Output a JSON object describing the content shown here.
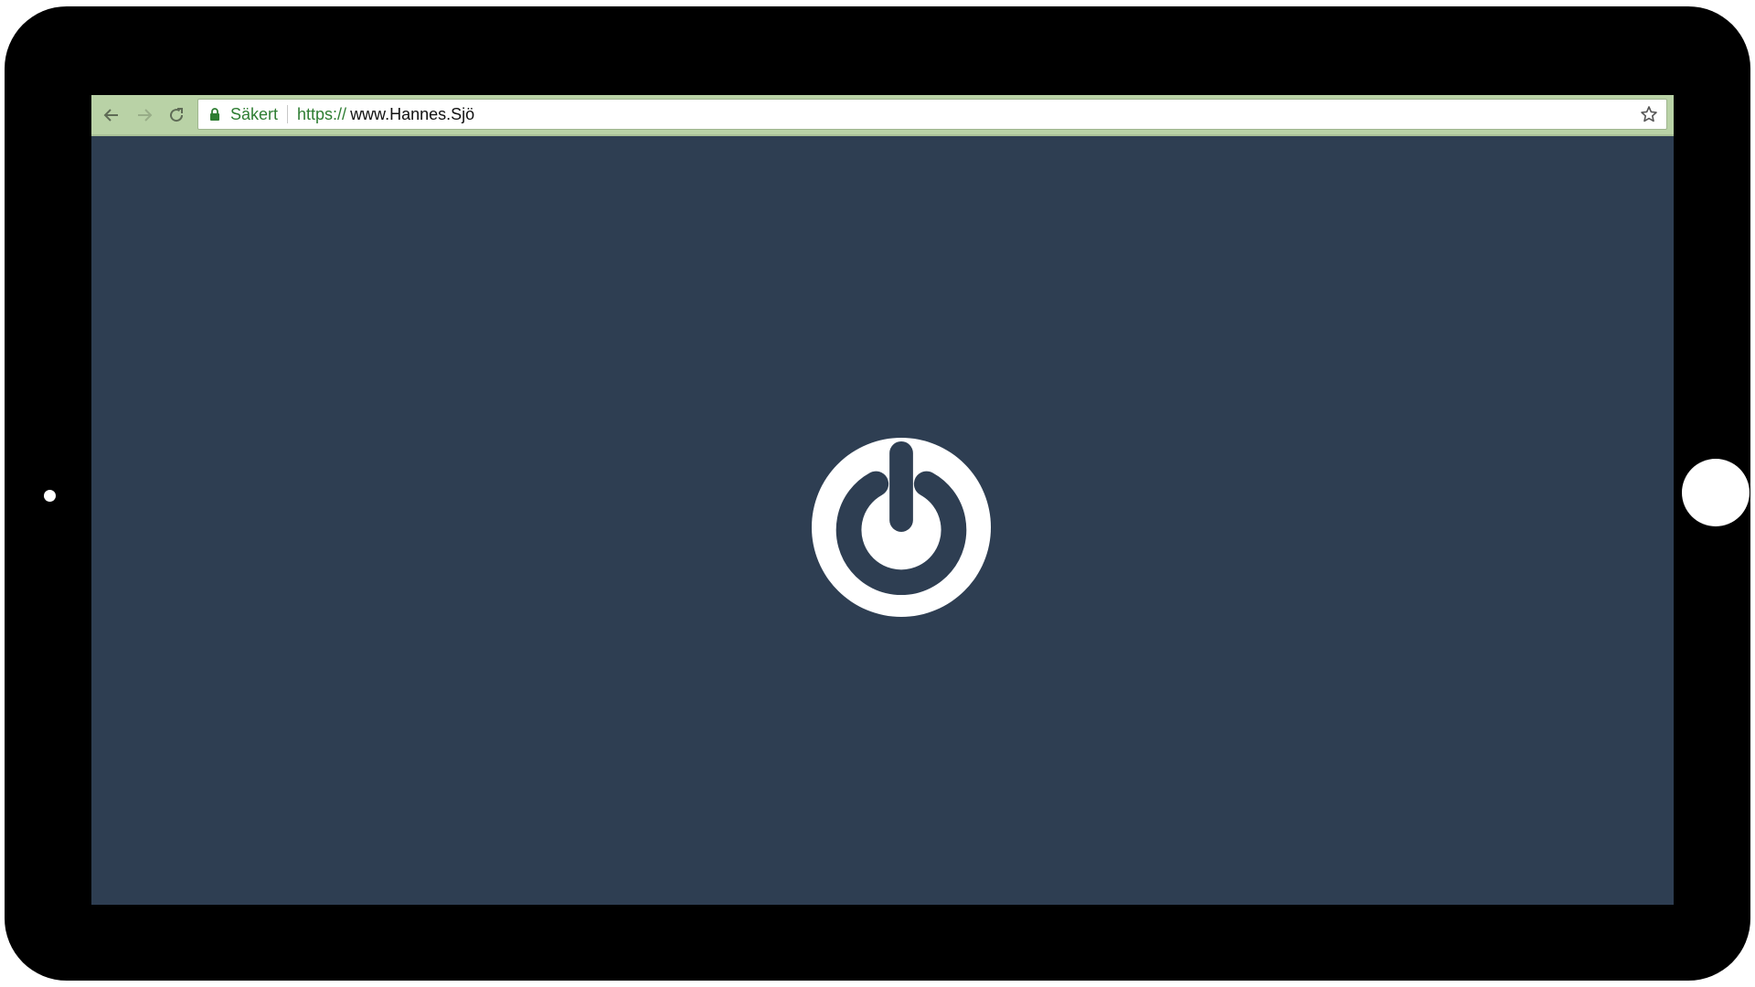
{
  "browser": {
    "secure_label": "Säkert",
    "url_scheme": "https://",
    "url_host": "www.Hannes.Sjö"
  },
  "icons": {
    "back": "arrow-left-icon",
    "forward": "arrow-right-icon",
    "reload": "reload-icon",
    "lock": "lock-icon",
    "bookmark": "star-icon",
    "content": "power-icon"
  },
  "colors": {
    "page_background": "#2e3e52",
    "toolbar": "#b9d2a6",
    "secure_green": "#2e7d32",
    "device_frame": "#000000"
  }
}
